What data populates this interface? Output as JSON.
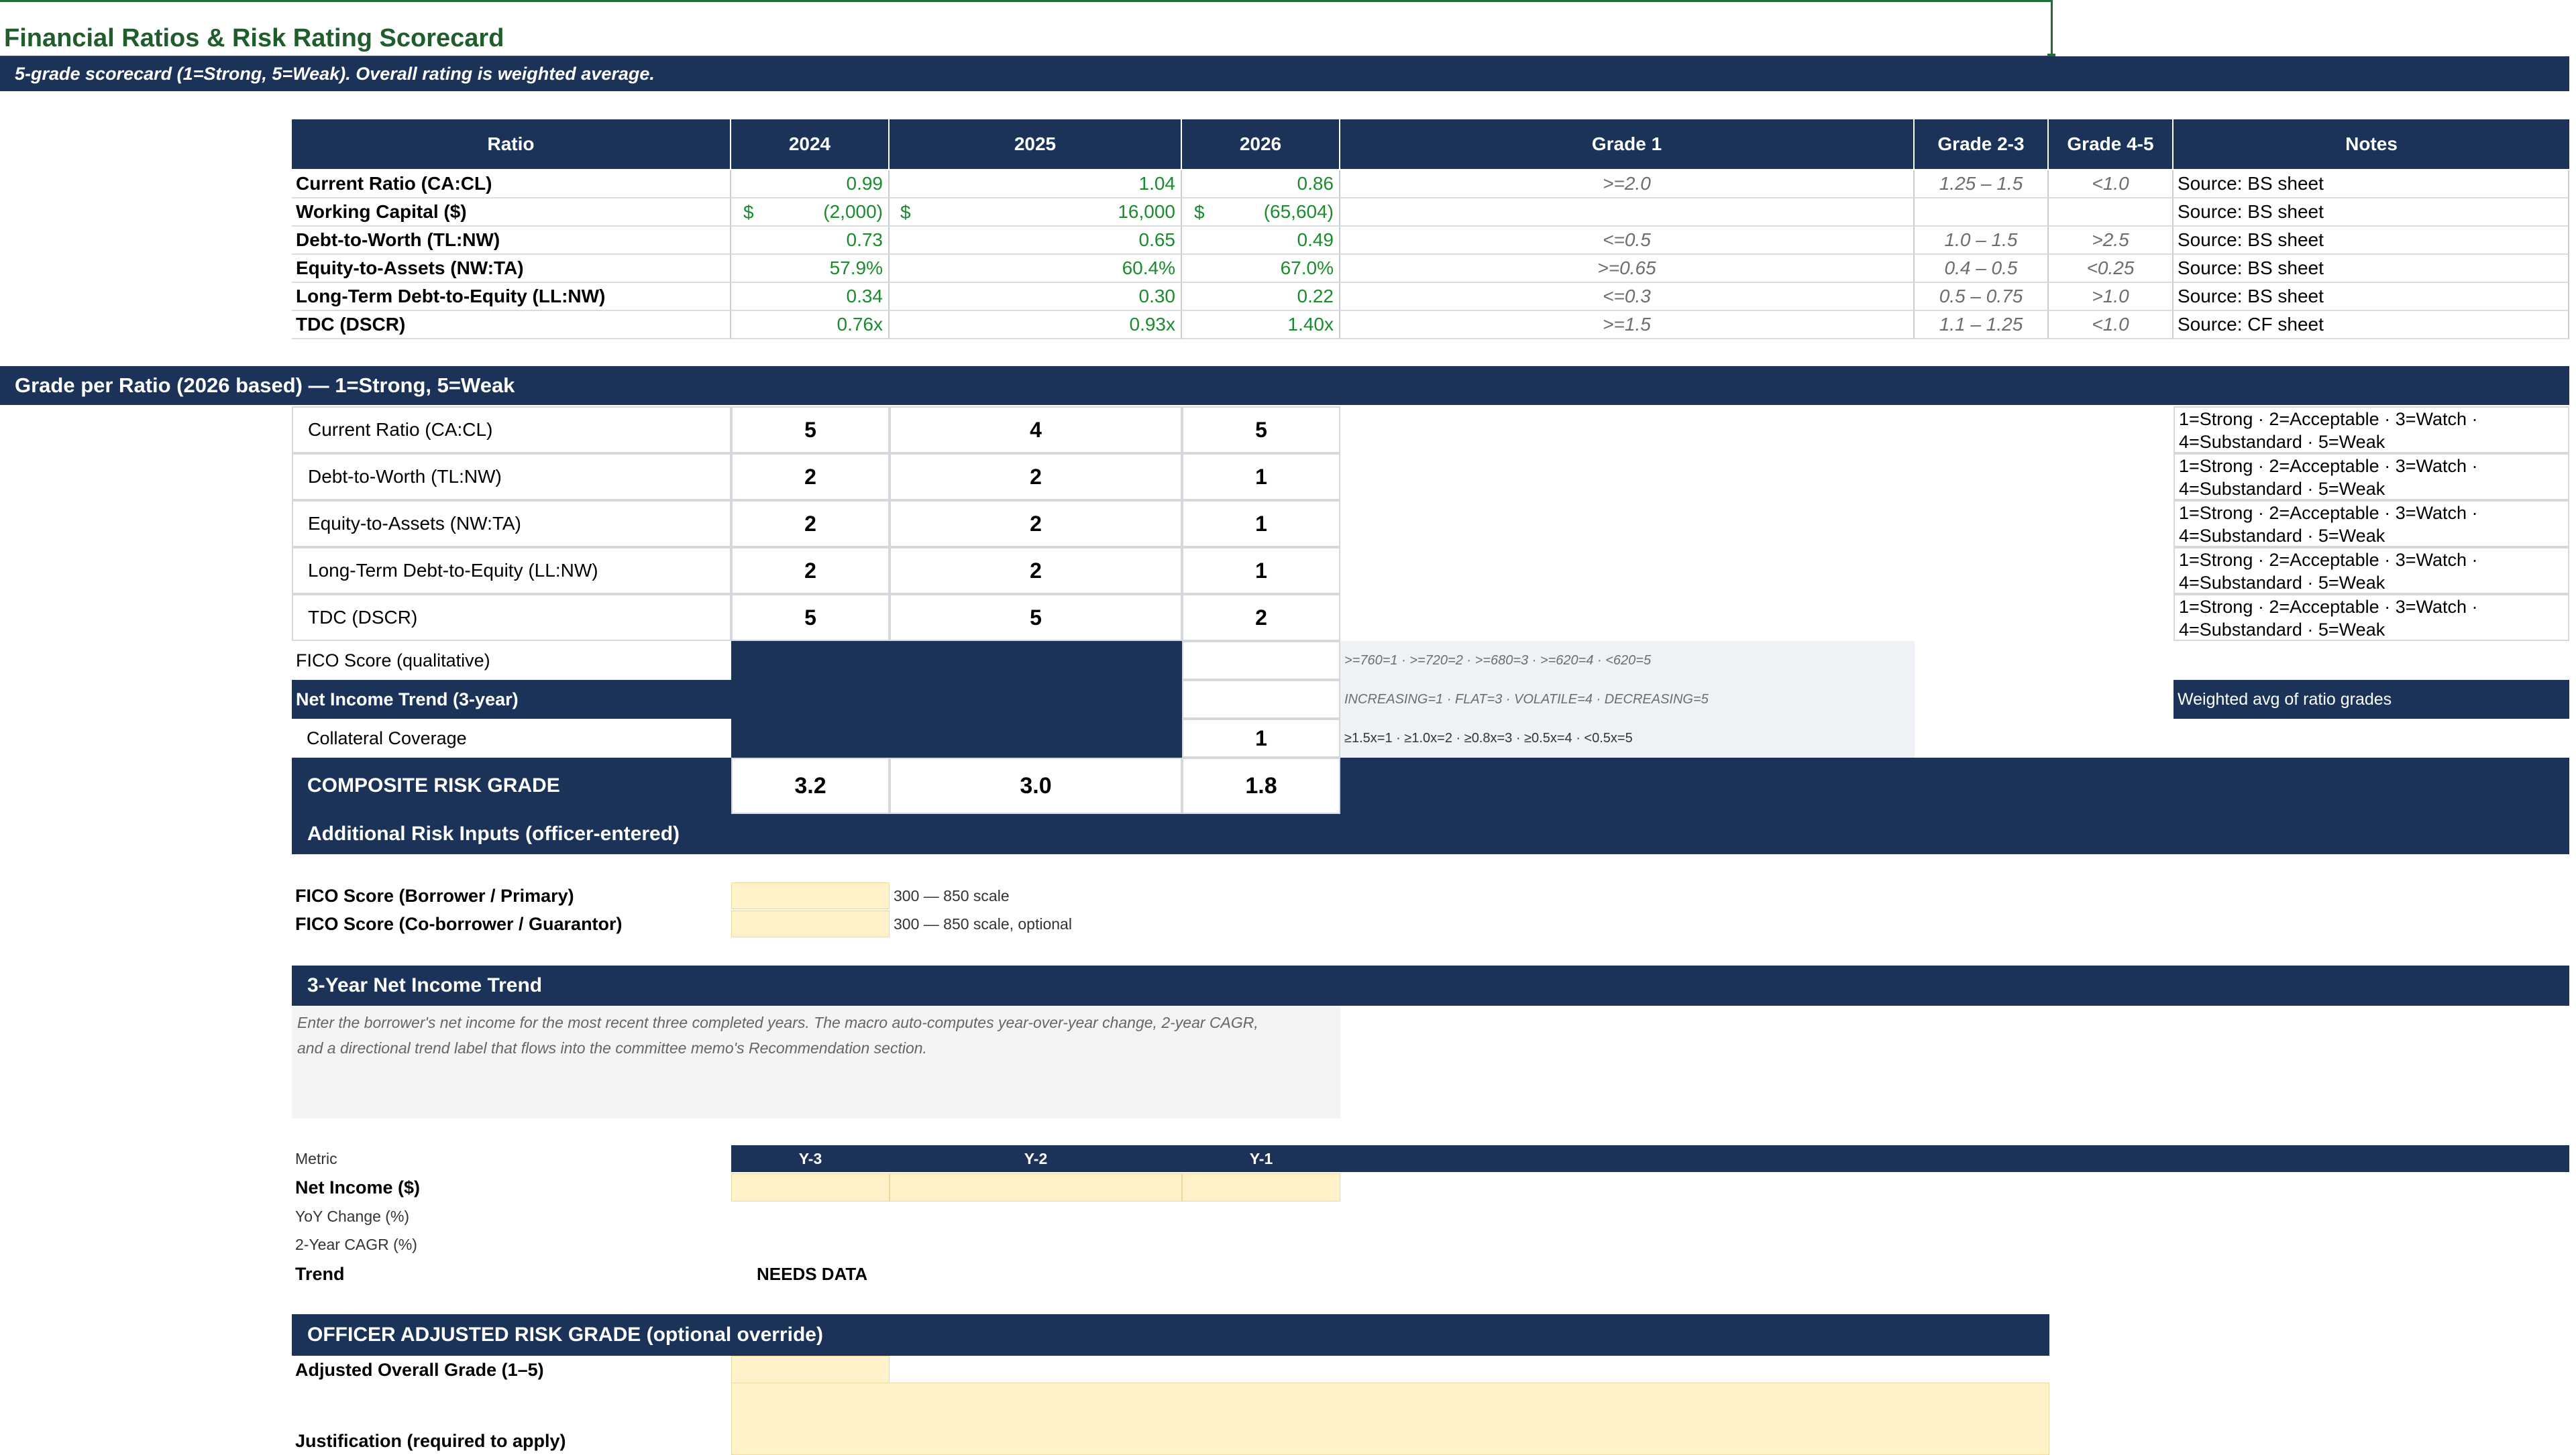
{
  "title": "Financial Ratios & Risk Rating Scorecard",
  "subtitle": "5-grade scorecard (1=Strong, 5=Weak).  Overall rating is weighted average.",
  "ratio_table": {
    "headers": [
      "Ratio",
      "2024",
      "2025",
      "2026",
      "Grade 1",
      "Grade 2-3",
      "Grade 4-5",
      "Notes"
    ],
    "rows": [
      {
        "name": "Current Ratio (CA:CL)",
        "y2024": "0.99",
        "y2025": "1.04",
        "y2026": "0.86",
        "g1": ">=2.0",
        "g23": "1.25 – 1.5",
        "g45": "<1.0",
        "note": "Source: BS sheet"
      },
      {
        "name": "Working Capital ($)",
        "cur": "$",
        "y2024": "(2,000)",
        "y2025": "16,000",
        "y2026": "(65,604)",
        "g1": "",
        "g23": "",
        "g45": "",
        "note": "Source: BS sheet"
      },
      {
        "name": "Debt-to-Worth (TL:NW)",
        "y2024": "0.73",
        "y2025": "0.65",
        "y2026": "0.49",
        "g1": "<=0.5",
        "g23": "1.0 – 1.5",
        "g45": ">2.5",
        "note": "Source: BS sheet"
      },
      {
        "name": "Equity-to-Assets (NW:TA)",
        "y2024": "57.9%",
        "y2025": "60.4%",
        "y2026": "67.0%",
        "g1": ">=0.65",
        "g23": "0.4 – 0.5",
        "g45": "<0.25",
        "note": "Source: BS sheet"
      },
      {
        "name": "Long-Term Debt-to-Equity (LL:NW)",
        "y2024": "0.34",
        "y2025": "0.30",
        "y2026": "0.22",
        "g1": "<=0.3",
        "g23": "0.5 – 0.75",
        "g45": ">1.0",
        "note": "Source: BS sheet"
      },
      {
        "name": "TDC (DSCR)",
        "y2024": "0.76x",
        "y2025": "0.93x",
        "y2026": "1.40x",
        "g1": ">=1.5",
        "g23": "1.1 – 1.25",
        "g45": "<1.0",
        "note": "Source: CF sheet"
      }
    ]
  },
  "grade_section": {
    "header": "Grade per Ratio (2026 based)  — 1=Strong, 5=Weak",
    "rows": [
      {
        "name": "Current Ratio (CA:CL)",
        "g2024": "5",
        "g2025": "4",
        "g2026": "5"
      },
      {
        "name": "Debt-to-Worth (TL:NW)",
        "g2024": "2",
        "g2025": "2",
        "g2026": "1"
      },
      {
        "name": "Equity-to-Assets (NW:TA)",
        "g2024": "2",
        "g2025": "2",
        "g2026": "1"
      },
      {
        "name": "Long-Term Debt-to-Equity (LL:NW)",
        "g2024": "2",
        "g2025": "2",
        "g2026": "1"
      },
      {
        "name": "TDC (DSCR)",
        "g2024": "5",
        "g2025": "5",
        "g2026": "2"
      }
    ],
    "legend_line1": "1=Strong · 2=Acceptable · 3=Watch ·",
    "legend_line2": "4=Substandard · 5=Weak",
    "fico_label": "FICO Score (qualitative)",
    "fico_scale": ">=760=1 · >=720=2 · >=680=3 · >=620=4 · <620=5",
    "trend_label": "Net Income Trend (3-year)",
    "trend_scale": "INCREASING=1 · FLAT=3 · VOLATILE=4 · DECREASING=5",
    "weighted_note": "Weighted avg of ratio grades",
    "collateral_label": "Collateral Coverage",
    "collateral_2026": "1",
    "collateral_scale": "≥1.5x=1 · ≥1.0x=2 · ≥0.8x=3 · ≥0.5x=4 · <0.5x=5",
    "composite_label": "COMPOSITE RISK GRADE",
    "composite_2024": "3.2",
    "composite_2025": "3.0",
    "composite_2026": "1.8"
  },
  "additional": {
    "header": "Additional Risk Inputs (officer-entered)",
    "fico_primary_label": "FICO Score (Borrower / Primary)",
    "fico_primary_hint": "300 — 850 scale",
    "fico_co_label": "FICO Score (Co-borrower / Guarantor)",
    "fico_co_hint": "300 — 850 scale, optional"
  },
  "trend": {
    "header": "3-Year Net Income Trend",
    "description_line1": "Enter the borrower's net income for the most recent three completed years. The macro auto-computes year-over-year change, 2-year CAGR,",
    "description_line2": "and a directional trend label that flows into the committee memo's Recommendation section.",
    "metric_label": "Metric",
    "cols": [
      "Y-3",
      "Y-2",
      "Y-1"
    ],
    "net_income_label": "Net Income ($)",
    "yoy_label": "YoY Change (%)",
    "cagr_label": "2-Year CAGR (%)",
    "trend_label": "Trend",
    "trend_value": "NEEDS DATA"
  },
  "override": {
    "header": "OFFICER ADJUSTED RISK GRADE (optional override)",
    "adjusted_label": "Adjusted Overall Grade (1–5)",
    "justification_label": "Justification (required to apply)"
  },
  "colors": {
    "navy": "#1b3358",
    "green": "#1a8c2e",
    "title_green": "#1f5e2c",
    "yellow": "#fff1c8"
  }
}
